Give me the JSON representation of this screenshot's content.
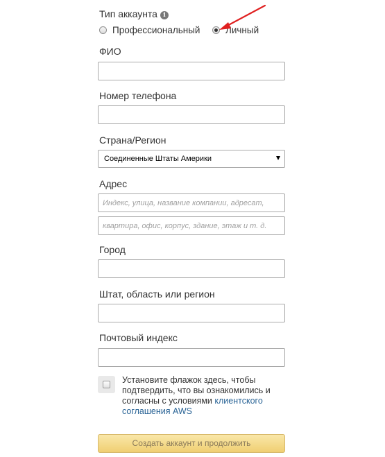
{
  "account_type": {
    "label": "Тип аккаунта",
    "info_glyph": "i",
    "options": [
      {
        "label": "Профессиональный",
        "selected": false
      },
      {
        "label": "Личный",
        "selected": true
      }
    ]
  },
  "fields": {
    "full_name": {
      "label": "ФИО",
      "value": "",
      "placeholder": ""
    },
    "phone": {
      "label": "Номер телефона",
      "value": "",
      "placeholder": ""
    },
    "country": {
      "label": "Страна/Регион",
      "selected": "Соединенные Штаты Америки"
    },
    "address": {
      "label": "Адрес",
      "line1_placeholder": "Индекс, улица, название компании, адресат,",
      "line2_placeholder": "квартира, офис, корпус, здание, этаж и т. д."
    },
    "city": {
      "label": "Город",
      "value": "",
      "placeholder": ""
    },
    "state": {
      "label": "Штат, область или регион",
      "value": "",
      "placeholder": ""
    },
    "postal_code": {
      "label": "Почтовый индекс",
      "value": "",
      "placeholder": ""
    }
  },
  "consent": {
    "text": "Установите флажок здесь, чтобы подтвердить, что вы ознакомились и согласны с условиями ",
    "link_text": "клиентского соглашения AWS",
    "checked": false
  },
  "submit": {
    "label": "Создать аккаунт и продолжить"
  },
  "colors": {
    "link": "#2a6496",
    "annotation_arrow": "#e02020",
    "button_bg": "#f0cf72"
  },
  "icons": {
    "info": "info-icon",
    "dropdown": "caret-down-icon",
    "annotation": "red-arrow-icon"
  }
}
